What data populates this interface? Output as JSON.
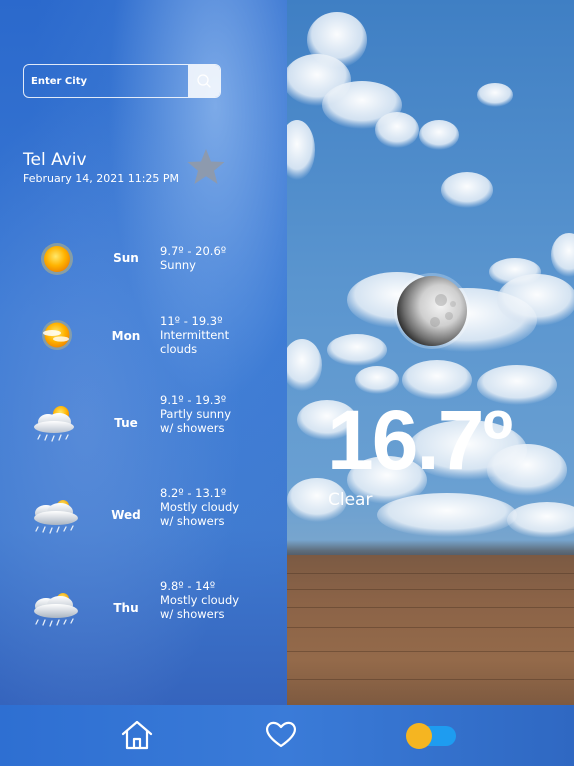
{
  "search": {
    "placeholder": "Enter City"
  },
  "location": {
    "city": "Tel Aviv",
    "datetime": "February 14, 2021 11:25 PM"
  },
  "forecast": [
    {
      "day": "Sun",
      "range": "9.7º - 20.6º",
      "description": "Sunny",
      "icon": "sunny-icon"
    },
    {
      "day": "Mon",
      "range": "11º - 19.3º",
      "description": "Intermittent clouds",
      "icon": "intermittent-clouds-icon"
    },
    {
      "day": "Tue",
      "range": "9.1º - 19.3º",
      "description": "Partly sunny w/ showers",
      "icon": "partly-sunny-showers-icon"
    },
    {
      "day": "Wed",
      "range": "8.2º - 13.1º",
      "description": "Mostly cloudy w/ showers",
      "icon": "mostly-cloudy-showers-icon"
    },
    {
      "day": "Thu",
      "range": "9.8º - 14º",
      "description": "Mostly cloudy w/ showers",
      "icon": "mostly-cloudy-showers-icon"
    }
  ],
  "current": {
    "temperature": "16.7º",
    "condition": "Clear"
  },
  "nav": {
    "items": [
      "home-icon",
      "favorites-icon",
      "theme-toggle"
    ]
  },
  "colors": {
    "primary_blue": "#2e6fd2",
    "toggle_yellow": "#f5b521",
    "toggle_blue": "#1e9cf0"
  }
}
